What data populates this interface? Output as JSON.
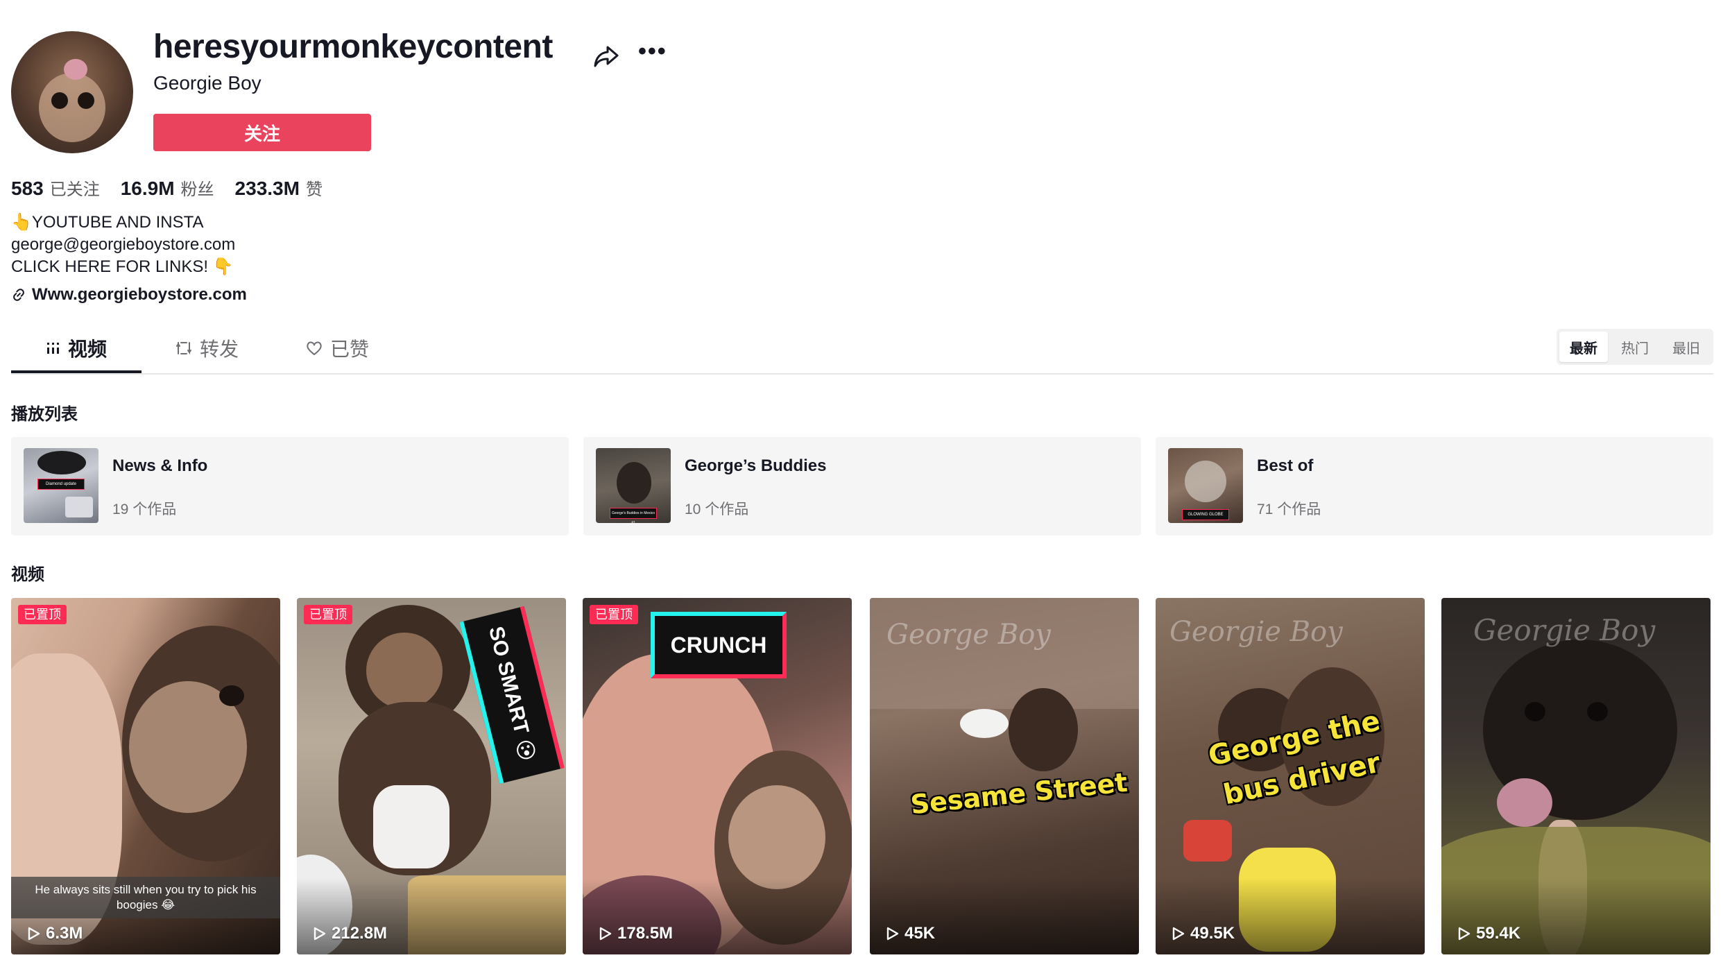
{
  "profile": {
    "username": "heresyourmonkeycontent",
    "nickname": "Georgie Boy",
    "follow_label": "关注",
    "stats": [
      {
        "value": "583",
        "label": "已关注"
      },
      {
        "value": "16.9M",
        "label": "粉丝"
      },
      {
        "value": "233.3M",
        "label": "赞"
      }
    ],
    "bio": [
      "👆YOUTUBE AND INSTA",
      "george@georgieboystore.com",
      "CLICK HERE FOR LINKS! 👇"
    ],
    "link": "Www.georgieboystore.com"
  },
  "tabs": [
    {
      "label": "视频",
      "icon": "grid-icon"
    },
    {
      "label": "转发",
      "icon": "repost-icon"
    },
    {
      "label": "已赞",
      "icon": "heart-icon"
    }
  ],
  "sort": [
    "最新",
    "热门",
    "最旧"
  ],
  "playlists_title": "播放列表",
  "playlists": [
    {
      "title": "News & Info",
      "count": "19 个作品",
      "thumb_tag": "Diamond update"
    },
    {
      "title": "George’s Buddies",
      "count": "10 个作品",
      "thumb_tag": "George's Buddies in Mexico #1"
    },
    {
      "title": "Best of",
      "count": "71 个作品",
      "thumb_tag": "GLOWING GLOBE"
    }
  ],
  "videos_title": "视频",
  "videos": [
    {
      "views": "6.3M",
      "pinned": "已置顶",
      "caption": "He always sits still when you try to pick his boogies 😂"
    },
    {
      "views": "212.8M",
      "pinned": "已置顶",
      "sticker": "SO SMART 😮"
    },
    {
      "views": "178.5M",
      "pinned": "已置顶",
      "sticker": "CRUNCH"
    },
    {
      "views": "45K",
      "overlay": "Sesame Street",
      "watermark": "George Boy"
    },
    {
      "views": "49.5K",
      "overlay_line1": "George the",
      "overlay_line2": "bus driver",
      "watermark": "Georgie Boy"
    },
    {
      "views": "59.4K",
      "watermark": "Georgie Boy"
    }
  ],
  "colors": {
    "accent": "#ea435e",
    "pin": "#fe2c55",
    "text": "#161823"
  }
}
